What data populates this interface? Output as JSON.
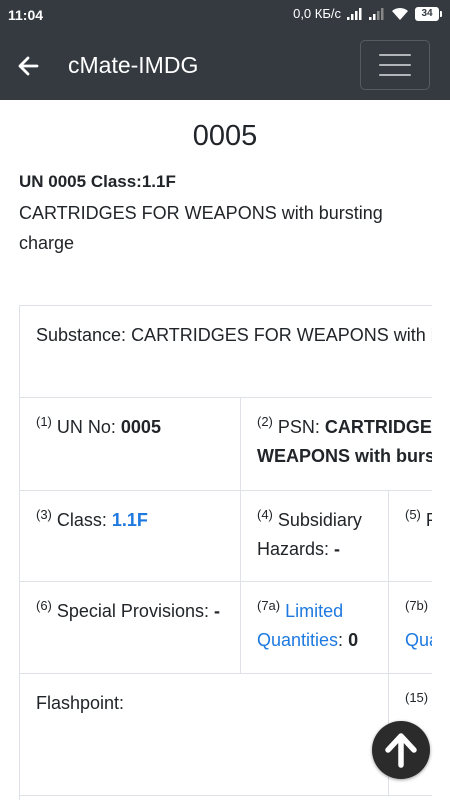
{
  "status_bar": {
    "time": "11:04",
    "network_speed": "0,0 КБ/с",
    "battery": "34"
  },
  "navbar": {
    "title": "cMate-IMDG"
  },
  "heading": "0005",
  "un_line": "UN 0005 Class:1.1F",
  "description": "CARTRIDGES FOR WEAPONS with bursting charge",
  "table": {
    "substance_label": "Substance: ",
    "substance_value": "CARTRIDGES FOR WEAPONS with bursting charge",
    "c1_num": "(1)",
    "c1_label": " UN No: ",
    "c1_value": "0005",
    "c2_num": "(2)",
    "c2_label": " PSN: ",
    "c2_value": "CARTRIDGES FOR WEAPONS with bursting charge",
    "c3_num": "(3)",
    "c3_label": " Class: ",
    "c3_value": "1.1F",
    "c4_num": "(4)",
    "c4_label": " Subsidiary Hazards: ",
    "c4_value": "-",
    "c5_num": "(5)",
    "c5_label": " Packing Group",
    "c6_num": "(6)",
    "c6_label": " Special Provisions: ",
    "c6_value": "-",
    "c7a_num": "(7a)",
    "c7a_label": "Limited Quantities",
    "c7a_value": "0",
    "c7b_num": "(7b)",
    "c7b_label": "Excepted Quantities",
    "flashpoint_label": "Flashpoint:",
    "c15_num": "(15)"
  },
  "colors": {
    "navbar": "#343a40",
    "link": "#1e7ae0"
  },
  "icons": {
    "back": "arrow-left-icon",
    "menu": "hamburger-icon",
    "scroll_top": "arrow-up-icon"
  }
}
